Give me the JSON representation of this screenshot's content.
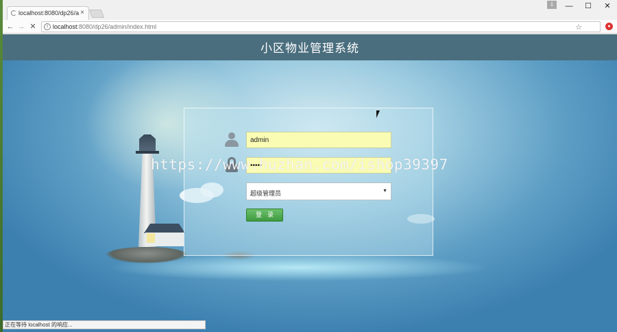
{
  "browser": {
    "tab_title": "localhost:8080/dp26/a",
    "tab_close": "×",
    "profile_label": "⇩",
    "window_controls": {
      "minimize": "—",
      "maximize": "☐",
      "close": "✕"
    },
    "nav": {
      "back": "←",
      "forward": "→",
      "stop": "✕"
    },
    "url_host": "localhost",
    "url_path": ":8080/dp26/admin/index.html",
    "star": "☆",
    "status_text": "正在等待 localhost 的响应..."
  },
  "page": {
    "title": "小区物业管理系统",
    "login": {
      "username_value": "admin",
      "password_value": "•••••",
      "role_selected": "超级管理员",
      "select_arrow": "▼",
      "submit_label": "登录"
    },
    "watermark": "https://www.huzhan.com/ishop39397"
  }
}
